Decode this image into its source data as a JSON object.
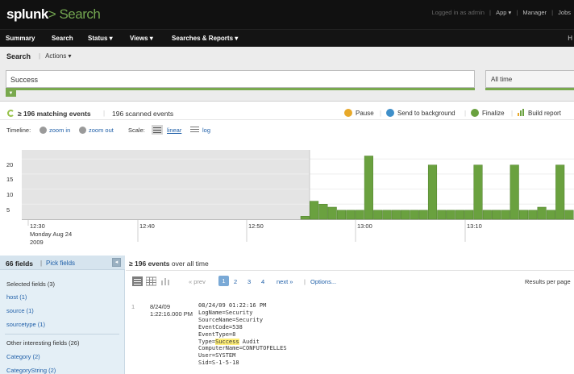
{
  "header": {
    "logo_main": "splunk",
    "logo_app": "> Search",
    "logged_in": "Logged in as admin",
    "app_menu": "App ▾",
    "manager": "Manager",
    "jobs": "Jobs"
  },
  "nav": {
    "items": [
      "Summary",
      "Search",
      "Status ▾",
      "Views ▾",
      "Searches & Reports ▾"
    ],
    "right_text": "H"
  },
  "search": {
    "title": "Search",
    "actions": "Actions ▾",
    "query": "Success",
    "time_range": "All time"
  },
  "status": {
    "matching": "≥ 196 matching events",
    "scanned": "196 scanned events",
    "pause": "Pause",
    "background": "Send to background",
    "finalize": "Finalize",
    "build_report": "Build report"
  },
  "timeline_controls": {
    "label": "Timeline:",
    "zoom_in": "zoom in",
    "zoom_out": "zoom out",
    "scale": "Scale:",
    "linear": "linear",
    "log": "log"
  },
  "chart_data": {
    "type": "bar",
    "y_ticks": [
      "20",
      "15",
      "10",
      "5"
    ],
    "ylim": [
      0,
      23
    ],
    "x_labels": [
      "12:30",
      "12:40",
      "12:50",
      "13:00",
      "13:10"
    ],
    "x_sublabel": [
      "Monday Aug 24",
      "2009"
    ],
    "values": [
      1,
      6,
      5,
      4,
      3,
      3,
      3,
      21,
      3,
      3,
      3,
      3,
      3,
      3,
      18,
      3,
      3,
      3,
      3,
      18,
      3,
      3,
      3,
      18,
      3,
      3,
      4,
      3,
      18,
      3,
      5,
      4,
      3,
      5
    ],
    "colors": {
      "bar": "#6aa13f",
      "bar_edge": "#4e7f2a",
      "shaded": "#e4e4e4",
      "grid": "#eeeeee"
    }
  },
  "fields": {
    "title": "66 fields",
    "pick": "Pick fields",
    "selected_header": "Selected fields (3)",
    "selected": [
      "host (1)",
      "source (1)",
      "sourcetype (1)"
    ],
    "other_header": "Other interesting fields (26)",
    "other": [
      "Category (2)",
      "CategoryString (2)"
    ]
  },
  "results": {
    "count": "≥ 196 events",
    "suffix": "over all time",
    "prev": "« prev",
    "pages": [
      "1",
      "2",
      "3",
      "4"
    ],
    "next": "next »",
    "options": "Options...",
    "per_page": "Results per page"
  },
  "event": {
    "num": "1",
    "date": "8/24/09",
    "time": "1:22:16.000 PM",
    "lines": [
      "08/24/09 01:22:16 PM",
      "LogName=Security",
      "SourceName=Security",
      "EventCode=538",
      "EventType=8",
      "Type=",
      "ComputerName=CONFUTOFELLES",
      "User=SYSTEM",
      "Sid=S-1-5-18"
    ],
    "type_highlight": "Success",
    "type_rest": " Audit"
  }
}
